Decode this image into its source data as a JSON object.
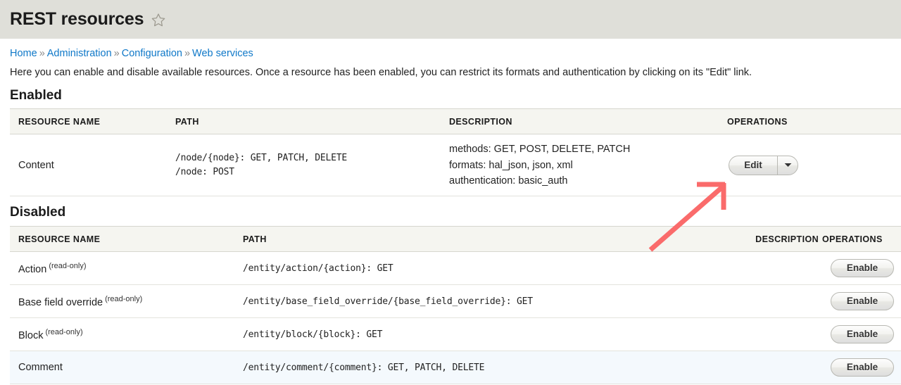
{
  "header": {
    "title": "REST resources",
    "star_icon": "star-outline-icon"
  },
  "breadcrumb": {
    "separator": "»",
    "items": [
      "Home",
      "Administration",
      "Configuration",
      "Web services"
    ]
  },
  "intro": "Here you can enable and disable available resources. Once a resource has been enabled, you can restrict its formats and authentication by clicking on its \"Edit\" link.",
  "enabled": {
    "heading": "Enabled",
    "columns": [
      "RESOURCE NAME",
      "PATH",
      "DESCRIPTION",
      "OPERATIONS"
    ],
    "rows": [
      {
        "name": "Content",
        "paths": [
          "/node/{node}: GET, PATCH, DELETE",
          "/node: POST"
        ],
        "description": [
          "methods: GET, POST, DELETE, PATCH",
          "formats: hal_json, json, xml",
          "authentication: basic_auth"
        ],
        "operation_label": "Edit",
        "operation_toggle_icon": "chevron-down-icon"
      }
    ]
  },
  "disabled": {
    "heading": "Disabled",
    "columns": [
      "RESOURCE NAME",
      "PATH",
      "DESCRIPTION",
      "OPERATIONS"
    ],
    "readonly_tag": "(read-only)",
    "rows": [
      {
        "name": "Action",
        "readonly": "(read-only)",
        "path": "/entity/action/{action}: GET",
        "description": "",
        "operation_label": "Enable"
      },
      {
        "name": "Base field override",
        "readonly": "(read-only)",
        "path": "/entity/base_field_override/{base_field_override}: GET",
        "description": "",
        "operation_label": "Enable"
      },
      {
        "name": "Block",
        "readonly": "(read-only)",
        "path": "/entity/block/{block}: GET",
        "description": "",
        "operation_label": "Enable"
      },
      {
        "name": "Comment",
        "readonly": "",
        "path": "/entity/comment/{comment}: GET, PATCH, DELETE",
        "description": "",
        "operation_label": "Enable"
      }
    ]
  },
  "annotation": {
    "type": "arrow",
    "color": "#fa6b6b",
    "points_to": "Edit"
  },
  "colors": {
    "header_band": "#dfdfd9",
    "table_header": "#f5f5f0",
    "link": "#0f78c8",
    "row_highlight": "#f4f9fd",
    "arrow": "#fa6b6b"
  }
}
